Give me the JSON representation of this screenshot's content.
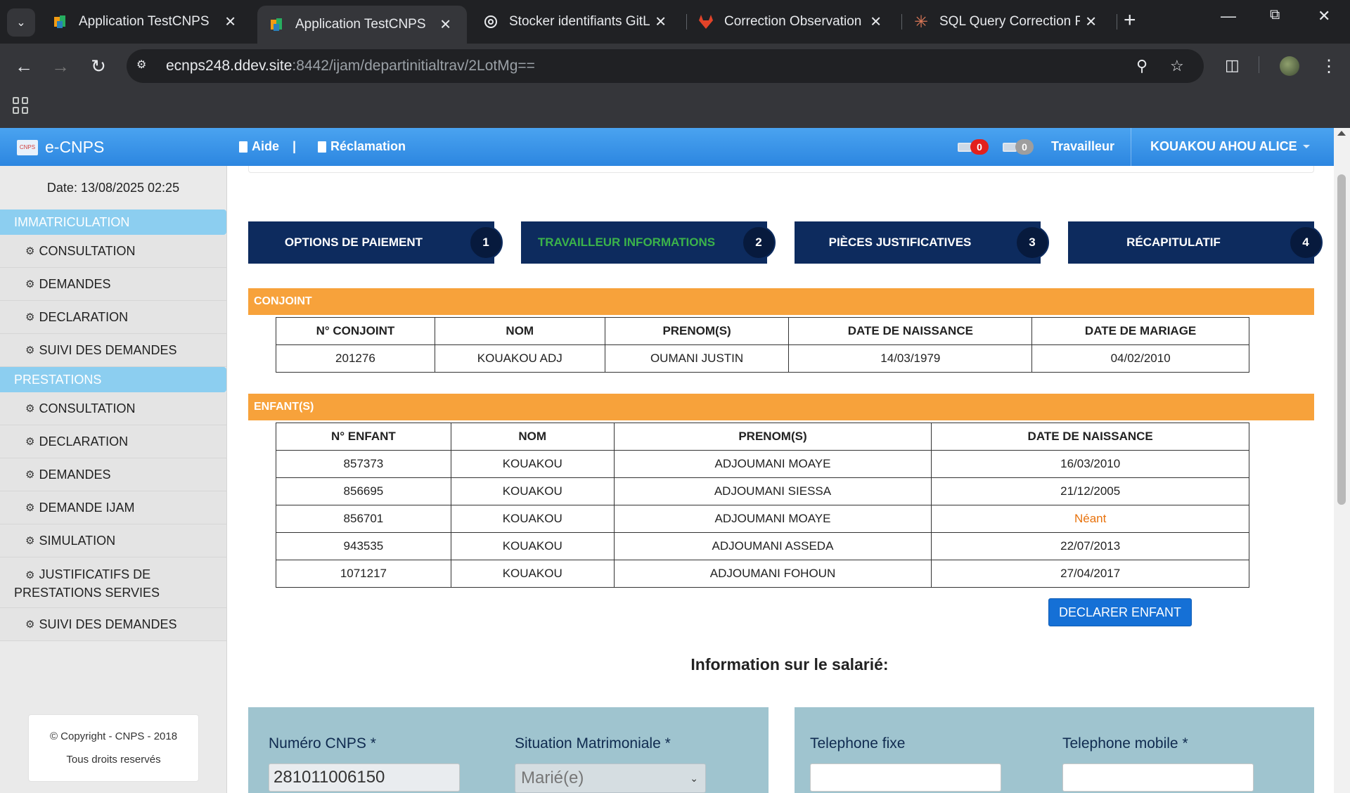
{
  "browser": {
    "tabs": [
      {
        "title": "Application TestCNPS",
        "active": false
      },
      {
        "title": "Application TestCNPS",
        "active": true
      },
      {
        "title": "Stocker identifiants GitLab",
        "active": false
      },
      {
        "title": "Correction Observation T",
        "active": false
      },
      {
        "title": "SQL Query Correction Re",
        "active": false
      }
    ],
    "url_host": "ecnps248.ddev.site",
    "url_rest": ":8442/ijam/departinitialtrav/2LotMg=="
  },
  "header": {
    "brand": "e-CNPS",
    "logo_text": "CNPS",
    "aide": "Aide",
    "separator": "|",
    "reclamation": "Réclamation",
    "mail_unread": "0",
    "mail_total": "0",
    "role": "Travailleur",
    "user": "KOUAKOU AHOU ALICE"
  },
  "sidebar": {
    "date": "Date: 13/08/2025 02:25",
    "sections": [
      {
        "title": "IMMATRICULATION",
        "items": [
          "CONSULTATION",
          "DEMANDES",
          "DECLARATION",
          "SUIVI DES DEMANDES"
        ]
      },
      {
        "title": "PRESTATIONS",
        "items": [
          "CONSULTATION",
          "DECLARATION",
          "DEMANDES",
          "DEMANDE IJAM",
          "SIMULATION",
          "JUSTIFICATIFS DE PRESTATIONS SERVIES",
          "SUIVI DES DEMANDES"
        ]
      }
    ],
    "copyright": "© Copyright - CNPS - 2018",
    "rights": "Tous droits reservés"
  },
  "steps": [
    {
      "label": "OPTIONS DE PAIEMENT",
      "num": "1"
    },
    {
      "label": "TRAVAILLEUR INFORMATIONS",
      "num": "2"
    },
    {
      "label": "PIÈCES JUSTIFICATIVES",
      "num": "3"
    },
    {
      "label": "RÉCAPITULATIF",
      "num": "4"
    }
  ],
  "conjoint": {
    "title": "CONJOINT",
    "headers": [
      "N° CONJOINT",
      "NOM",
      "PRENOM(S)",
      "DATE DE NAISSANCE",
      "DATE DE MARIAGE"
    ],
    "rows": [
      [
        "201276",
        "KOUAKOU ADJ",
        "OUMANI JUSTIN",
        "14/03/1979",
        "04/02/2010"
      ]
    ]
  },
  "enfants": {
    "title": "ENFANT(S)",
    "headers": [
      "N° ENFANT",
      "NOM",
      "PRENOM(S)",
      "DATE DE NAISSANCE"
    ],
    "rows": [
      [
        "857373",
        "KOUAKOU",
        "ADJOUMANI MOAYE",
        "16/03/2010"
      ],
      [
        "856695",
        "KOUAKOU",
        "ADJOUMANI SIESSA",
        "21/12/2005"
      ],
      [
        "856701",
        "KOUAKOU",
        "ADJOUMANI MOAYE",
        "Néant"
      ],
      [
        "943535",
        "KOUAKOU",
        "ADJOUMANI ASSEDA",
        "22/07/2013"
      ],
      [
        "1071217",
        "KOUAKOU",
        "ADJOUMANI FOHOUN",
        "27/04/2017"
      ]
    ]
  },
  "declare_button": "DECLARER ENFANT",
  "info_title": "Information sur le salarié:",
  "form": {
    "cnps_label": "Numéro CNPS *",
    "cnps_value": "281011006150",
    "situation_label": "Situation Matrimoniale *",
    "situation_value": "Marié(e)",
    "tel_fixe_label": "Telephone fixe",
    "tel_fixe_value": "",
    "tel_mobile_label": "Telephone mobile *",
    "tel_mobile_value": ""
  },
  "colors": {
    "header_blue": "#3a96ea",
    "step_navy": "#0d2b5e",
    "section_orange": "#f7a23b",
    "active_step_green": "#3bb34a",
    "badge_red": "#e2211c",
    "panel_teal": "#9fc4cf"
  }
}
